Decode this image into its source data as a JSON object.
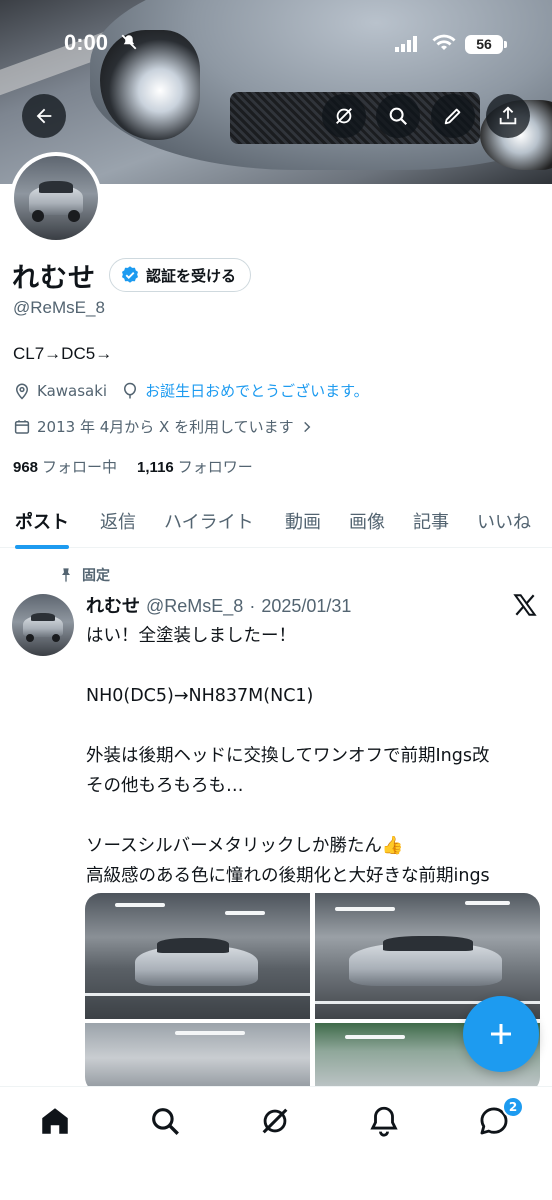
{
  "status_bar": {
    "time": "0:00",
    "battery": "56"
  },
  "profile": {
    "name": "れむせ",
    "verify_button": "認証を受ける",
    "handle": "@ReMsE_8",
    "bio": "CL7→DC5→",
    "location": "Kawasaki",
    "birthday": "お誕生日おめでとうございます。",
    "joined": "2013 年 4月から X を利用しています",
    "following_count": "968",
    "following_label": "フォロー中",
    "followers_count": "1,116",
    "followers_label": "フォロワー"
  },
  "tabs": [
    {
      "label": "ポスト"
    },
    {
      "label": "返信"
    },
    {
      "label": "ハイライト"
    },
    {
      "label": "動画"
    },
    {
      "label": "画像"
    },
    {
      "label": "記事"
    },
    {
      "label": "いいね"
    }
  ],
  "post": {
    "pinned_label": "固定",
    "author_name": "れむせ",
    "author_handle": "@ReMsE_8",
    "separator": "·",
    "date": "2025/01/31",
    "text": "はい！全塗装しましたー！\n\nNH0(DC5)→NH837M(NC1)\n\n外装は後期ヘッドに交換してワンオフで前期Ings改\nその他もろもろも…\n\nソースシルバーメタリックしか勝たん👍\n高級感のある色に憧れの後期化と大好きな前期ings\nとの組合せは最強すぎる✌️"
  },
  "nav": {
    "messages_badge": "2"
  },
  "icons": {
    "back": "arrow-left-icon",
    "grok": "grok-icon",
    "search": "search-icon",
    "edit": "pencil-icon",
    "share": "share-icon",
    "location": "location-pin-icon",
    "birthday": "balloon-icon",
    "calendar": "calendar-icon",
    "pin": "pin-icon",
    "home": "home-icon",
    "notifications": "bell-icon",
    "messages": "message-icon",
    "compose": "plus-icon"
  },
  "colors": {
    "accent": "#1d9bf0",
    "text": "#0f1419",
    "secondary": "#536471"
  }
}
